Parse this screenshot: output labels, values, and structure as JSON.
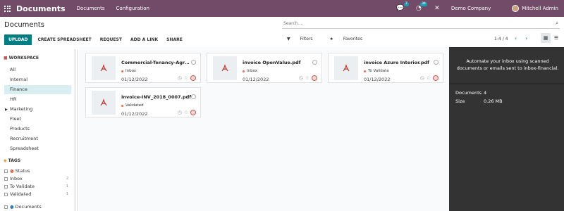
{
  "navbar": {
    "app_title": "Documents",
    "menu": [
      "Documents",
      "Configuration"
    ],
    "chat_badge": "7",
    "activity_badge": "34",
    "company": "Demo Company",
    "user": "Mitchell Admin"
  },
  "control": {
    "breadcrumb": "Documents",
    "search_placeholder": "Search...",
    "buttons": [
      "UPLOAD",
      "CREATE SPREADSHEET",
      "REQUEST",
      "ADD A LINK",
      "SHARE"
    ],
    "filters_label": "Filters",
    "favorites_label": "Favorites",
    "pager": "1-4 / 4"
  },
  "sidebar": {
    "workspace_header": "WORKSPACE",
    "workspaces": [
      "All",
      "Internal",
      "Finance",
      "HR",
      "Marketing",
      "Fleet",
      "Products",
      "Recruitment",
      "Spreadsheet"
    ],
    "active_workspace": "Finance",
    "tags_header": "TAGS",
    "tag_group": "Status",
    "tags": [
      {
        "label": "Inbox",
        "count": "2"
      },
      {
        "label": "To Validate",
        "count": "1"
      },
      {
        "label": "Validated",
        "count": "1"
      }
    ],
    "bottom_group": "Documents"
  },
  "cards": [
    {
      "name": "Commercial-Tenancy-Agreem...",
      "tag": "Inbox",
      "date": "01/12/2022"
    },
    {
      "name": "invoice OpenValue.pdf",
      "tag": "Inbox",
      "date": "01/12/2022"
    },
    {
      "name": "invoice Azure Interior.pdf",
      "tag": "To Validate",
      "date": "01/12/2022"
    },
    {
      "name": "Invoice-INV_2018_0007.pdf",
      "tag": "Validated",
      "date": "01/12/2022"
    }
  ],
  "inspector": {
    "message": "Automate your inbox using scanned documents or emails sent to inbox-financial.",
    "documents_label": "Documents",
    "documents_value": "4",
    "size_label": "Size",
    "size_value": "0.26 MB"
  },
  "colors": {
    "navbar": "#714b67",
    "primary_button": "#017e84",
    "active_item": "#d8eef0",
    "inspector_bg": "#333333",
    "pdf_red": "#c0392b"
  }
}
